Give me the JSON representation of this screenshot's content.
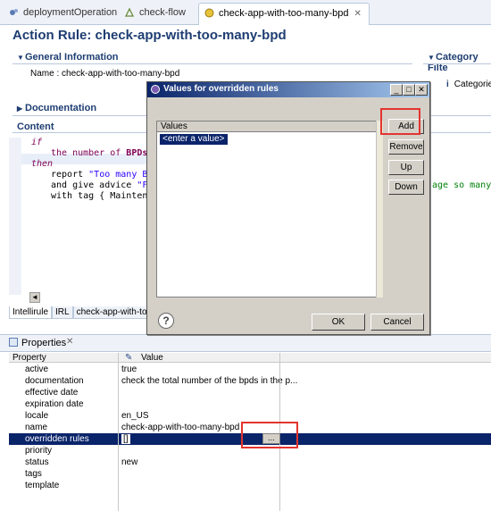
{
  "tabs": [
    {
      "label": "deploymentOperation"
    },
    {
      "label": "check-flow"
    },
    {
      "label": "check-app-with-too-many-bpd"
    }
  ],
  "editor": {
    "title": "Action Rule: check-app-with-too-many-bpd",
    "general_info": "General Information",
    "name_label": "Name :",
    "name_value": "check-app-with-too-many-bpd",
    "category_filter": "Category Filte",
    "categories": "Categories",
    "documentation": "Documentation",
    "content": "Content"
  },
  "code": {
    "line_if": "if",
    "line2_a": "the number of ",
    "line2_b": "BPDs",
    "line2_c": " i",
    "line_then": "then",
    "line4_a": "report ",
    "line4_b": "\"Too many BPD",
    "line5_a": "and give advice ",
    "line5_b": "\"Fo",
    "line5_c": "age so many",
    "line6": "with tag { Maintenan"
  },
  "bottom_tabs": [
    "Intellirule",
    "IRL",
    "check-app-with-too-ma"
  ],
  "properties": {
    "view_title": "Properties",
    "col_property": "Property",
    "col_value": "Value",
    "rows": [
      {
        "key": "active",
        "value": "true"
      },
      {
        "key": "documentation",
        "value": "check the total number of the bpds in the p..."
      },
      {
        "key": "effective date",
        "value": ""
      },
      {
        "key": "expiration date",
        "value": ""
      },
      {
        "key": "locale",
        "value": "en_US"
      },
      {
        "key": "name",
        "value": "check-app-with-too-many-bpd"
      },
      {
        "key": "overridden rules",
        "value": "[]"
      },
      {
        "key": "priority",
        "value": ""
      },
      {
        "key": "status",
        "value": "new"
      },
      {
        "key": "tags",
        "value": ""
      },
      {
        "key": "template",
        "value": ""
      }
    ],
    "ellipsis_button": "..."
  },
  "dialog": {
    "title": "Values for overridden rules",
    "list_header": "Values",
    "placeholder_item": "<enter a value>",
    "add": "Add",
    "remove": "Remove",
    "up": "Up",
    "down": "Down",
    "ok": "OK",
    "cancel": "Cancel",
    "help_glyph": "?"
  },
  "colors": {
    "selection": "#0a246a",
    "highlight_box": "#e3342f",
    "title": "#1e3d72"
  }
}
